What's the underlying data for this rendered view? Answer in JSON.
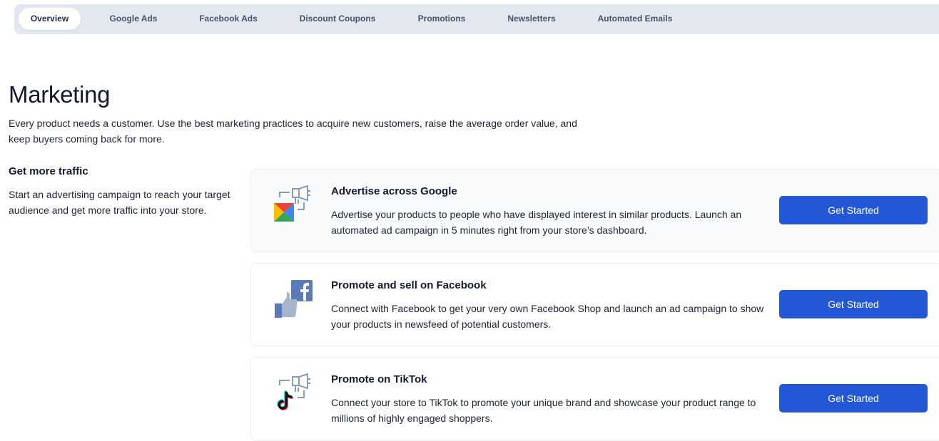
{
  "tabs": [
    {
      "label": "Overview",
      "active": true
    },
    {
      "label": "Google Ads",
      "active": false
    },
    {
      "label": "Facebook Ads",
      "active": false
    },
    {
      "label": "Discount Coupons",
      "active": false
    },
    {
      "label": "Promotions",
      "active": false
    },
    {
      "label": "Newsletters",
      "active": false
    },
    {
      "label": "Automated Emails",
      "active": false
    }
  ],
  "page": {
    "title": "Marketing",
    "subtitle": "Every product needs a customer. Use the best marketing practices to acquire new customers, raise the average order value, and keep buyers coming back for more."
  },
  "traffic_section": {
    "title": "Get more traffic",
    "description": "Start an advertising campaign to reach your target audience and get more traffic into your store."
  },
  "cards": [
    {
      "icon": "google-megaphone-icon",
      "title": "Advertise across Google",
      "description": "Advertise your products to people who have displayed interest in similar products. Launch an automated ad campaign in 5 minutes right from your store’s dashboard.",
      "button_label": "Get Started"
    },
    {
      "icon": "facebook-thumbs-up-icon",
      "title": "Promote and sell on Facebook",
      "description": "Connect with Facebook to get your very own Facebook Shop and launch an ad campaign to show your products in newsfeed of potential customers.",
      "button_label": "Get Started"
    },
    {
      "icon": "tiktok-megaphone-icon",
      "title": "Promote on TikTok",
      "description": "Connect your store to TikTok to promote your unique brand and showcase your product range to millions of highly engaged shoppers.",
      "button_label": "Get Started"
    }
  ],
  "colors": {
    "accent": "#2457d6",
    "tabbar_bg": "#e3e7ef",
    "text_primary": "#0f1a2e"
  }
}
